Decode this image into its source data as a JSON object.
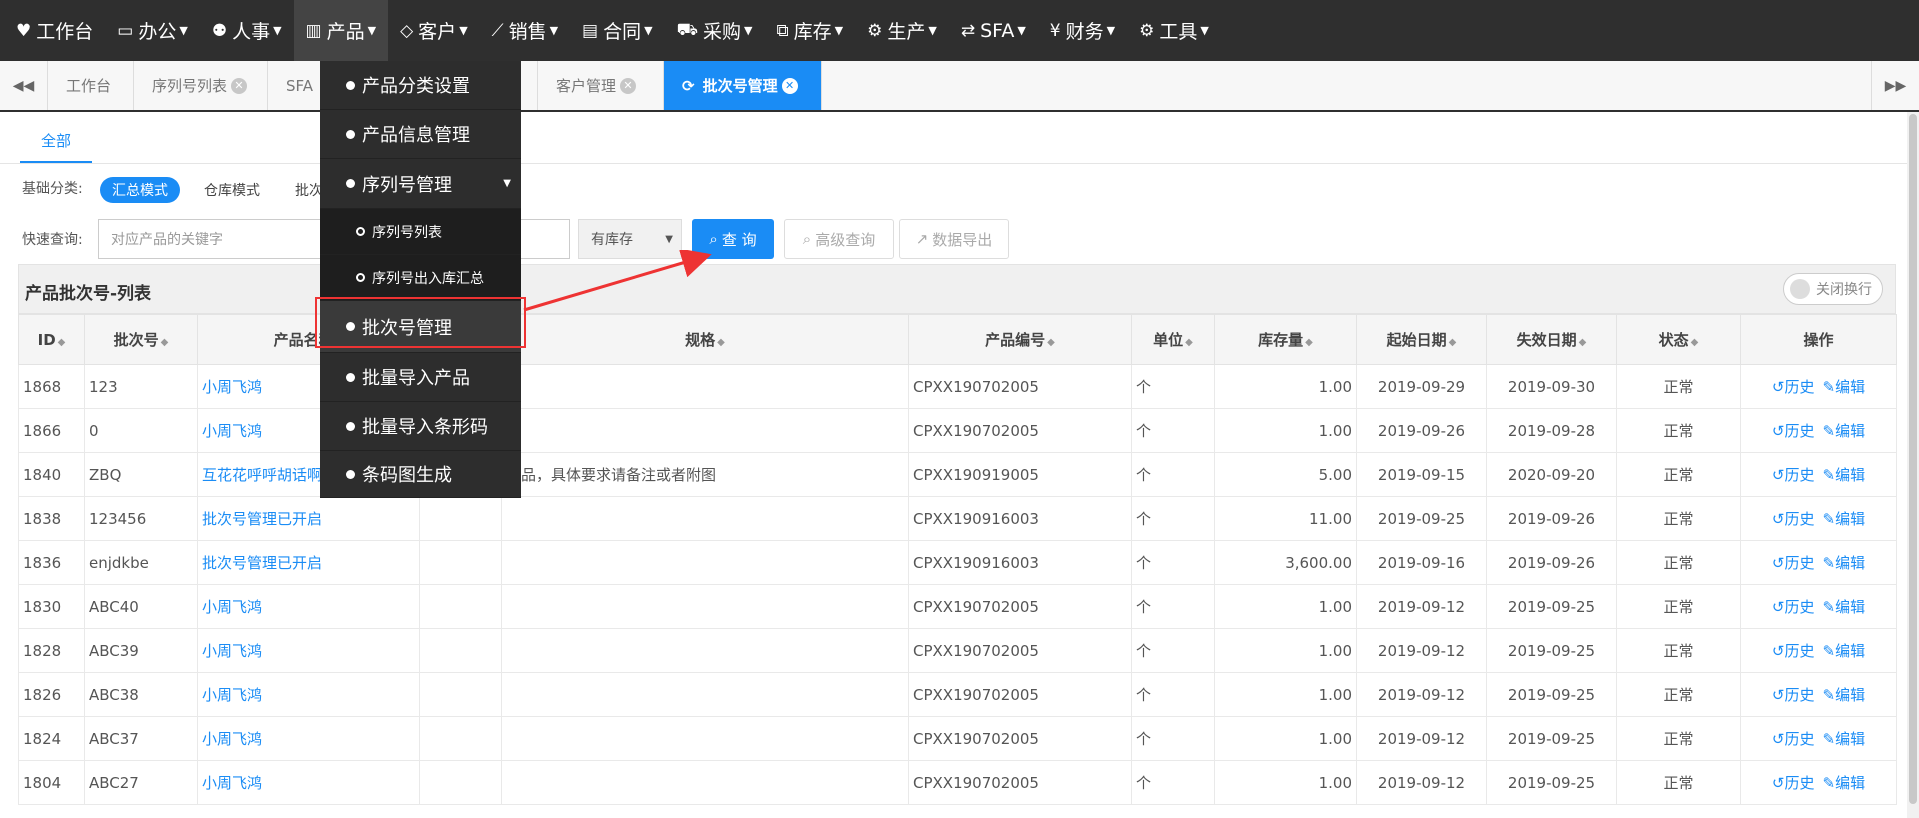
{
  "topnav": [
    {
      "label": "工作台",
      "icon": "heart-icon",
      "glyph": "♥",
      "caret": false
    },
    {
      "label": "办公",
      "icon": "laptop-icon",
      "glyph": "▭",
      "caret": true
    },
    {
      "label": "人事",
      "icon": "users-icon",
      "glyph": "⚉",
      "caret": true
    },
    {
      "label": "产品",
      "icon": "barcode-icon",
      "glyph": "▥",
      "caret": true,
      "active": true
    },
    {
      "label": "客户",
      "icon": "diamond-icon",
      "glyph": "◇",
      "caret": true
    },
    {
      "label": "销售",
      "icon": "line-chart-icon",
      "glyph": "⟋",
      "caret": true
    },
    {
      "label": "合同",
      "icon": "contract-icon",
      "glyph": "▤",
      "caret": true
    },
    {
      "label": "采购",
      "icon": "cart-icon",
      "glyph": "⛟",
      "caret": true
    },
    {
      "label": "库存",
      "icon": "cubes-icon",
      "glyph": "⧉",
      "caret": true
    },
    {
      "label": "生产",
      "icon": "cogs-icon",
      "glyph": "⚙",
      "caret": true
    },
    {
      "label": "SFA",
      "icon": "retweet-icon",
      "glyph": "⇄",
      "caret": true
    },
    {
      "label": "财务",
      "icon": "yen-icon",
      "glyph": "¥",
      "caret": true
    },
    {
      "label": "工具",
      "icon": "gear-icon",
      "glyph": "⚙",
      "caret": true
    }
  ],
  "tabs": [
    {
      "label": "工作台",
      "closable": false
    },
    {
      "label": "序列号列表",
      "closable": true
    },
    {
      "label": "SFA",
      "closable": false
    },
    {
      "label": "客户管理",
      "closable": true
    },
    {
      "label": "批次号管理",
      "closable": true,
      "active": true
    }
  ],
  "subtab": "全部",
  "filter": {
    "base_label": "基础分类:",
    "modes": [
      "汇总模式",
      "仓库模式",
      "批次"
    ],
    "quick_label": "快速查询:",
    "quick_placeholder": "对应产品的关键字",
    "stock_select": "有库存",
    "query_btn": "查 询",
    "advanced_btn": "高级查询",
    "export_btn": "数据导出"
  },
  "panel": {
    "title": "产品批次号-列表",
    "toggle": "关闭换行"
  },
  "columns": [
    "ID",
    "批次号",
    "产品名称",
    "",
    "规格",
    "产品编号",
    "单位",
    "库存量",
    "起始日期",
    "失效日期",
    "状态",
    "操作"
  ],
  "rows": [
    {
      "id": "1868",
      "batch": "123",
      "name": "小周飞鸿",
      "spec": "",
      "code": "CPXX190702005",
      "unit": "个",
      "qty": "1.00",
      "start": "2019-09-29",
      "end": "2019-09-30",
      "status": "正常"
    },
    {
      "id": "1866",
      "batch": "0",
      "name": "小周飞鸿",
      "spec": "",
      "code": "CPXX190702005",
      "unit": "个",
      "qty": "1.00",
      "start": "2019-09-26",
      "end": "2019-09-28",
      "status": "正常"
    },
    {
      "id": "1840",
      "batch": "ZBQ",
      "name": "互花花呼呼胡话啊",
      "spec": "制品，具体要求请备注或者附图",
      "code": "CPXX190919005",
      "unit": "个",
      "qty": "5.00",
      "start": "2019-09-15",
      "end": "2020-09-20",
      "status": "正常"
    },
    {
      "id": "1838",
      "batch": "123456",
      "name": "批次号管理已开启",
      "spec": "",
      "code": "CPXX190916003",
      "unit": "个",
      "qty": "11.00",
      "start": "2019-09-25",
      "end": "2019-09-26",
      "status": "正常"
    },
    {
      "id": "1836",
      "batch": "enjdkbe",
      "name": "批次号管理已开启",
      "spec": "",
      "code": "CPXX190916003",
      "unit": "个",
      "qty": "3,600.00",
      "start": "2019-09-16",
      "end": "2019-09-26",
      "status": "正常"
    },
    {
      "id": "1830",
      "batch": "ABC40",
      "name": "小周飞鸿",
      "spec": "",
      "code": "CPXX190702005",
      "unit": "个",
      "qty": "1.00",
      "start": "2019-09-12",
      "end": "2019-09-25",
      "status": "正常"
    },
    {
      "id": "1828",
      "batch": "ABC39",
      "name": "小周飞鸿",
      "spec": "",
      "code": "CPXX190702005",
      "unit": "个",
      "qty": "1.00",
      "start": "2019-09-12",
      "end": "2019-09-25",
      "status": "正常"
    },
    {
      "id": "1826",
      "batch": "ABC38",
      "name": "小周飞鸿",
      "spec": "",
      "code": "CPXX190702005",
      "unit": "个",
      "qty": "1.00",
      "start": "2019-09-12",
      "end": "2019-09-25",
      "status": "正常"
    },
    {
      "id": "1824",
      "batch": "ABC37",
      "name": "小周飞鸿",
      "spec": "",
      "code": "CPXX190702005",
      "unit": "个",
      "qty": "1.00",
      "start": "2019-09-12",
      "end": "2019-09-25",
      "status": "正常"
    },
    {
      "id": "1804",
      "batch": "ABC27",
      "name": "小周飞鸿",
      "spec": "",
      "code": "CPXX190702005",
      "unit": "个",
      "qty": "1.00",
      "start": "2019-09-12",
      "end": "2019-09-25",
      "status": "正常"
    }
  ],
  "ops": {
    "history": "历史",
    "edit": "编辑"
  },
  "dropdown": [
    {
      "label": "产品分类设置",
      "type": "main"
    },
    {
      "label": "产品信息管理",
      "type": "main"
    },
    {
      "label": "序列号管理",
      "type": "main",
      "caret": true
    },
    {
      "label": "序列号列表",
      "type": "sub"
    },
    {
      "label": "序列号出入库汇总",
      "type": "sub"
    },
    {
      "label": "批次号管理",
      "type": "main",
      "highlight": true
    },
    {
      "label": "批量导入产品",
      "type": "main"
    },
    {
      "label": "批量导入条形码",
      "type": "main"
    },
    {
      "label": "条码图生成",
      "type": "main"
    }
  ],
  "colors": {
    "primary": "#1a8cf5",
    "nav_bg": "#2f2f2f",
    "highlight": "#e33333"
  }
}
